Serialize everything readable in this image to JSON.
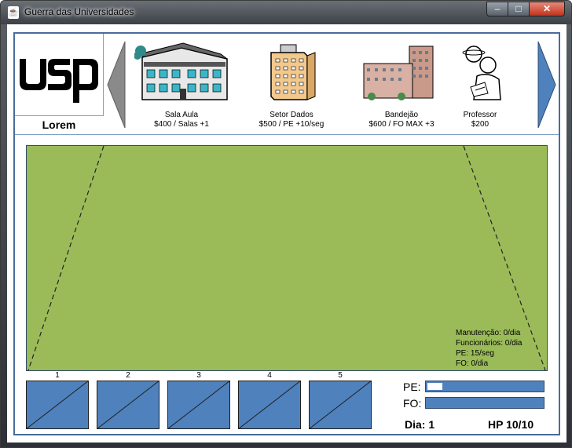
{
  "window": {
    "title": "Guerra das Universidades",
    "app_icon": "java-cup-icon",
    "controls": {
      "minimize": "–",
      "maximize": "□",
      "close": "✕"
    }
  },
  "logo": {
    "text": "USP",
    "name": "Lorem"
  },
  "shop": {
    "items": [
      {
        "name": "Sala Aula",
        "price": "$400 / Salas +1",
        "icon": "classroom-building-icon"
      },
      {
        "name": "Setor Dados",
        "price": "$500 / PE +10/seg",
        "icon": "data-sector-building-icon"
      },
      {
        "name": "Bandejão",
        "price": "$600 / FO MAX +3",
        "icon": "cafeteria-building-icon"
      },
      {
        "name": "Professor",
        "price": "$200",
        "icon": "professor-icon"
      }
    ]
  },
  "stats": {
    "manutencao": "Manutenção: 0/dia",
    "funcionarios": "Funcionários: 0/dia",
    "pe": "PE: 15/seg",
    "fo": "FO: 0/dia"
  },
  "slots": [
    "1",
    "2",
    "3",
    "4",
    "5"
  ],
  "bars": {
    "pe_label": "PE:",
    "pe_level": 0.13,
    "fo_label": "FO:",
    "fo_level": 0
  },
  "status": {
    "dia": "Dia: 1",
    "hp": "HP 10/10"
  },
  "colors": {
    "field": "#9bbb59",
    "slot": "#4f81bd",
    "border": "#4a6c9a",
    "arrow_left": "#8a8a8a",
    "arrow_right": "#4f81bd"
  }
}
